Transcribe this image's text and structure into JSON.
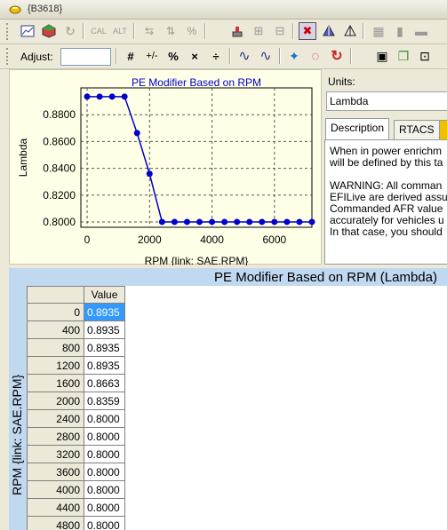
{
  "window": {
    "title": "{B3618}",
    "title_icon": "flame-icon"
  },
  "toolbar1": {
    "buttons": [
      {
        "name": "chart-icon"
      },
      {
        "name": "cube-3d-icon"
      },
      {
        "name": "refresh-icon"
      },
      {
        "name": "cal-button",
        "label": "CAL"
      },
      {
        "name": "alt-button",
        "label": "ALT"
      },
      {
        "name": "arrows-icon"
      },
      {
        "name": "plusminus-arrows-icon"
      },
      {
        "name": "percent-icon"
      },
      {
        "name": "stamp-icon"
      },
      {
        "name": "add-icon"
      },
      {
        "name": "minus-icon"
      },
      {
        "name": "cross-icon"
      },
      {
        "name": "pyramid-icon"
      },
      {
        "name": "triangle-icon"
      },
      {
        "name": "grid-icon"
      },
      {
        "name": "bar-icon"
      },
      {
        "name": "dash-icon"
      }
    ]
  },
  "toolbar2": {
    "adjust_label": "Adjust:",
    "adjust_value": "",
    "buttons": [
      "#",
      "+/-",
      "%",
      "×",
      "÷",
      "∿",
      "∿",
      "✦",
      "◌",
      "↻"
    ]
  },
  "chart_data": {
    "type": "line",
    "title": "PE Modifier Based on RPM",
    "xlabel": "RPM {link: SAE.RPM}",
    "ylabel": "Lambda",
    "x": [
      0,
      400,
      800,
      1200,
      1600,
      2000,
      2400,
      2800,
      3200,
      3600,
      4000,
      4400,
      4800,
      5200,
      5600,
      6000,
      6400,
      6800,
      7200
    ],
    "values": [
      0.8935,
      0.8935,
      0.8935,
      0.8935,
      0.8663,
      0.8359,
      0.8,
      0.8,
      0.8,
      0.8,
      0.8,
      0.8,
      0.8,
      0.8,
      0.8,
      0.8,
      0.8,
      0.8,
      0.8
    ],
    "xticks": [
      "0",
      "2000",
      "4000",
      "6000"
    ],
    "yticks": [
      "0.8000",
      "0.8200",
      "0.8400",
      "0.8600",
      "0.8800"
    ],
    "xlim": [
      -200,
      7200
    ],
    "ylim": [
      0.796,
      0.9
    ],
    "grid": true,
    "line_color": "#0000cc",
    "point_color": "#0000cc"
  },
  "units": {
    "label": "Units:",
    "value": "Lambda"
  },
  "tabs": [
    {
      "label": "Description",
      "active": true
    },
    {
      "label": "RTACS",
      "active": false
    }
  ],
  "description_lines": [
    "When in power enrichm",
    "will be defined by this ta",
    "",
    "WARNING: All comman",
    "EFILive are derived assu",
    "Commanded AFR value",
    "accurately for vehicles u",
    "In that case, you should"
  ],
  "table": {
    "title": "PE Modifier Based on RPM (Lambda)",
    "row_axis_label": "RPM {link: SAE.RPM}",
    "column_header": "Value",
    "rows": [
      {
        "rpm": "0",
        "value": "0.8935"
      },
      {
        "rpm": "400",
        "value": "0.8935"
      },
      {
        "rpm": "800",
        "value": "0.8935"
      },
      {
        "rpm": "1200",
        "value": "0.8935"
      },
      {
        "rpm": "1600",
        "value": "0.8663"
      },
      {
        "rpm": "2000",
        "value": "0.8359"
      },
      {
        "rpm": "2400",
        "value": "0.8000"
      },
      {
        "rpm": "2800",
        "value": "0.8000"
      },
      {
        "rpm": "3200",
        "value": "0.8000"
      },
      {
        "rpm": "3600",
        "value": "0.8000"
      },
      {
        "rpm": "4000",
        "value": "0.8000"
      },
      {
        "rpm": "4400",
        "value": "0.8000"
      },
      {
        "rpm": "4800",
        "value": "0.8000"
      }
    ],
    "header_color": "#c0d8f0",
    "selection_color": "#3399ff"
  }
}
